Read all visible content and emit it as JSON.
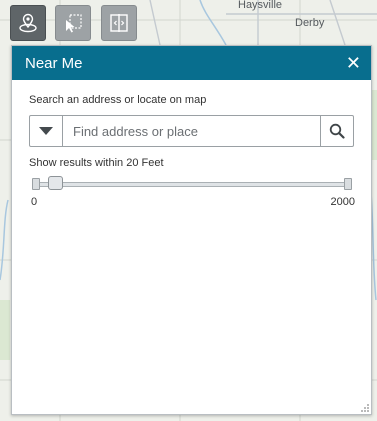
{
  "map": {
    "labels": [
      "Haysville",
      "Derby"
    ]
  },
  "toolbar": {
    "buttons": [
      {
        "icon": "near-me-icon",
        "active": true
      },
      {
        "icon": "select-icon",
        "active": false
      },
      {
        "icon": "swipe-icon",
        "active": false
      }
    ]
  },
  "panel": {
    "title": "Near Me",
    "close_label": "✕",
    "instructions": "Search an address or locate on map",
    "search": {
      "placeholder": "Find address or place",
      "value": ""
    },
    "radius_label": "Show results within 20 Feet",
    "slider": {
      "min": "0",
      "max": "2000",
      "value": 20
    }
  },
  "colors": {
    "header": "#086e8e",
    "toolbar_active": "#5f6568",
    "toolbar_inactive": "#9da2a5"
  }
}
